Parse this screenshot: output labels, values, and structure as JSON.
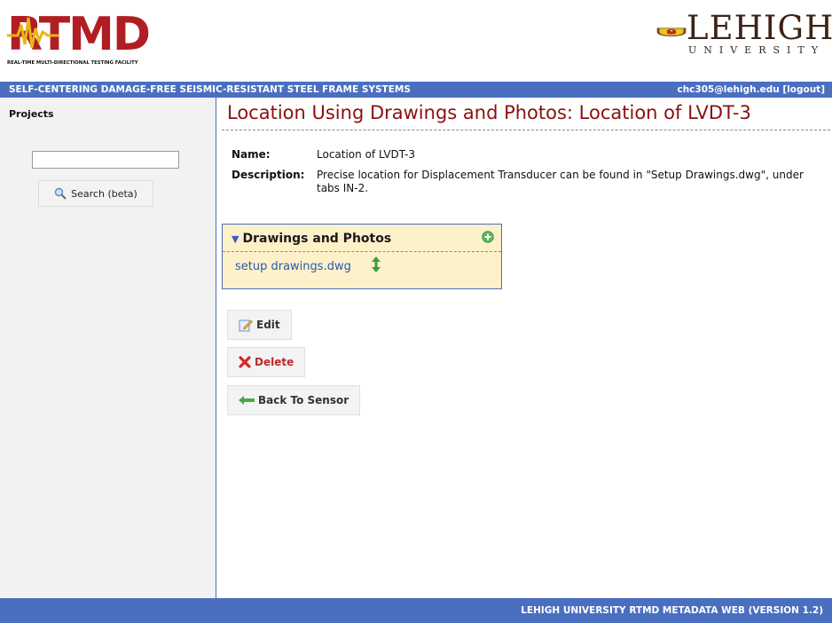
{
  "header": {
    "rtmd_logo_text": "RTMD",
    "rtmd_logo_subtitle": "REAL-TIME MULTI-DIRECTIONAL TESTING FACILITY",
    "lehigh_name": "LEHIGH",
    "lehigh_subtitle": "UNIVERSITY"
  },
  "titlebar": {
    "project_name": "SELF-CENTERING DAMAGE-FREE SEISMIC-RESISTANT STEEL FRAME SYSTEMS",
    "user_logout": "chc305@lehigh.edu [logout]"
  },
  "sidebar": {
    "heading": "Projects",
    "search_value": "",
    "search_button": "Search (beta)"
  },
  "main": {
    "title": "Location Using Drawings and Photos: Location of LVDT-3",
    "name_label": "Name:",
    "name_value": "Location of LVDT-3",
    "description_label": "Description:",
    "description_value": "Precise location for Displacement Transducer can be found in \"Setup Drawings.dwg\", under tabs IN-2."
  },
  "panel": {
    "title": "Drawings and Photos",
    "files": [
      "setup drawings.dwg"
    ]
  },
  "actions": {
    "edit": "Edit",
    "delete": "Delete",
    "back": "Back To Sensor"
  },
  "footer": {
    "text": "LEHIGH UNIVERSITY RTMD METADATA WEB (VERSION 1.2)"
  },
  "colors": {
    "accent_blue": "#4a6fc0",
    "title_red": "#8b1010",
    "panel_bg": "#fdf1c9",
    "link_blue": "#2d57b5"
  }
}
